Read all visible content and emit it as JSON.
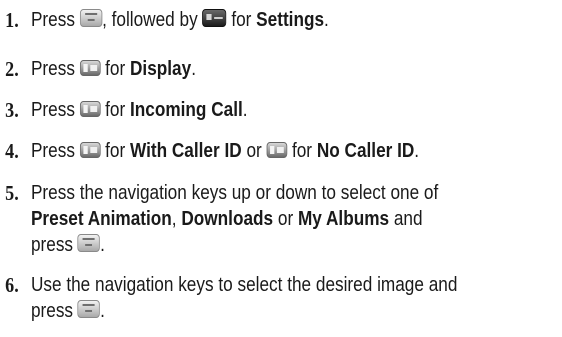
{
  "steps": [
    {
      "number": "1.",
      "w1": "Press",
      "w2": ", followed by",
      "w3": "for",
      "settings": "Settings",
      "period": ".",
      "icons": [
        "menu-ok-key-icon",
        "pound-key-icon"
      ]
    },
    {
      "number": "2.",
      "w1": "Press",
      "w2": "for",
      "display": "Display",
      "period": ".",
      "icons": [
        "one-key-icon"
      ]
    },
    {
      "number": "3.",
      "w1": "Press",
      "w2": "for",
      "incoming": "Incoming Call",
      "period": ".",
      "icons": [
        "five-key-icon"
      ]
    },
    {
      "number": "4.",
      "w1": "Press",
      "w2": "for",
      "with_caller": "With Caller ID",
      "or": "or",
      "w3": "for",
      "no_caller": "No Caller ID",
      "period": ".",
      "icons": [
        "one-key-icon",
        "two-key-icon"
      ]
    },
    {
      "number": "5.",
      "line1": "Press the navigation keys up or down to select one of",
      "preset": "Preset Animation",
      "comma": ",",
      "downloads": "Downloads",
      "or": "or",
      "albums": "My Albums",
      "and": "and",
      "press": "press",
      "period": ".",
      "icons": [
        "menu-ok-key-icon"
      ]
    },
    {
      "number": "6.",
      "line1": "Use the navigation keys to select the desired image and",
      "press": "press",
      "period": ".",
      "icons": [
        "menu-ok-key-icon"
      ]
    }
  ]
}
